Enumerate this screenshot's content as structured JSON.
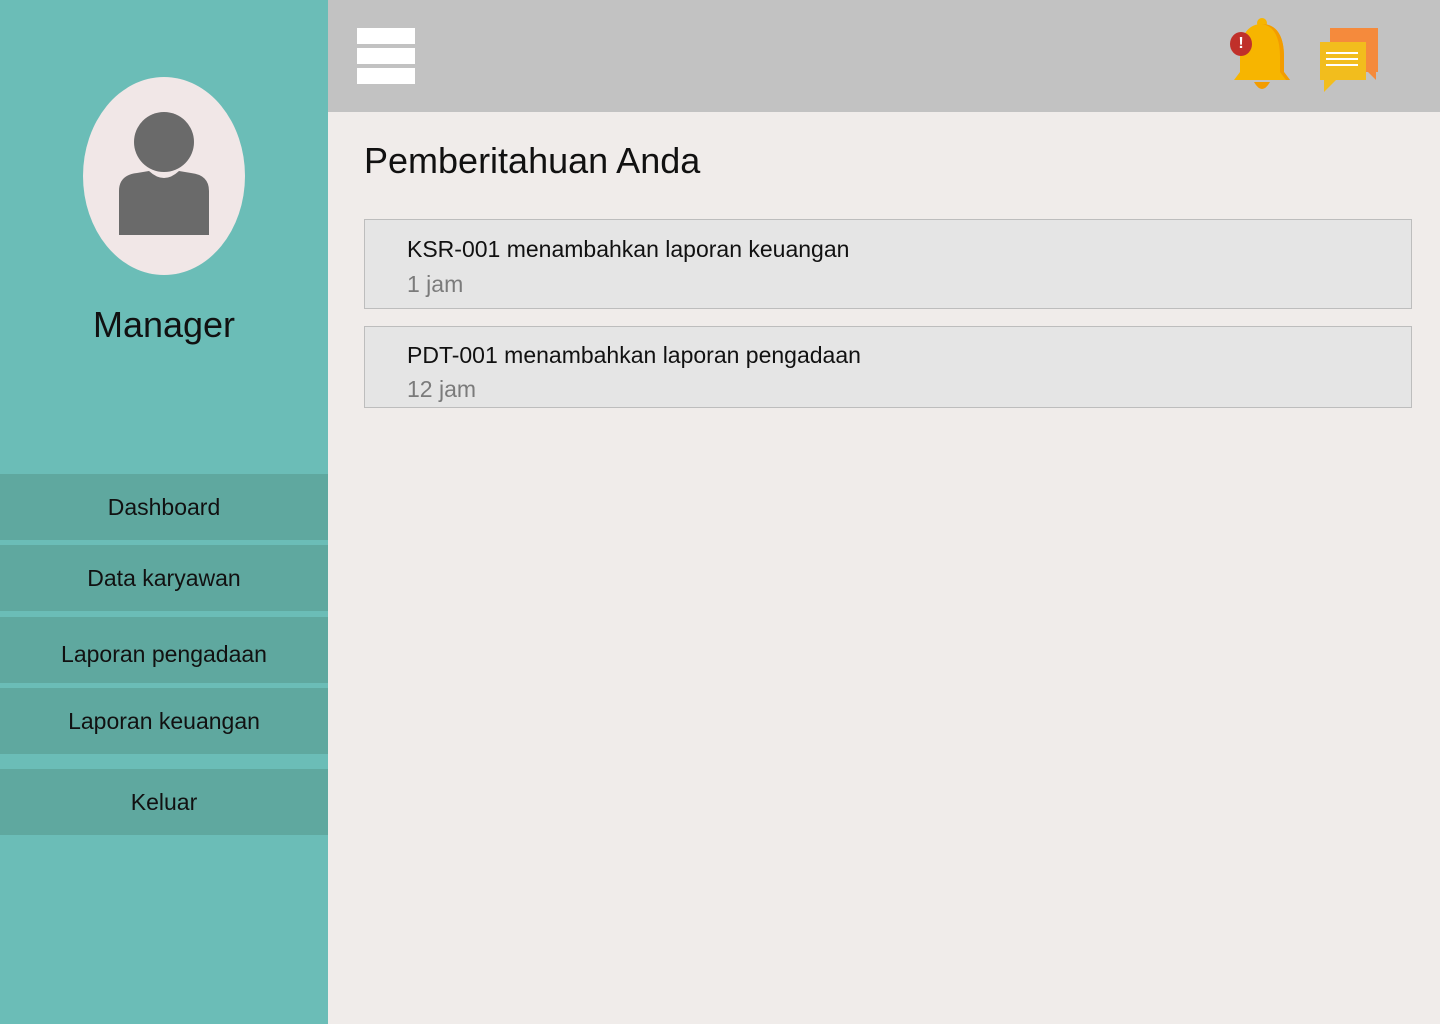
{
  "sidebar": {
    "role": "Manager",
    "items": [
      {
        "label": "Dashboard"
      },
      {
        "label": "Data karyawan"
      },
      {
        "label": "Laporan pengadaan"
      },
      {
        "label": "Laporan keuangan"
      },
      {
        "label": "Keluar"
      }
    ]
  },
  "header": {
    "menu_icon": "hamburger-icon",
    "notification_icon": "bell-icon",
    "notification_badge": "!",
    "message_icon": "chat-icon"
  },
  "main": {
    "title": "Pemberitahuan Anda",
    "notifications": [
      {
        "message": "KSR-001 menambahkan laporan keuangan",
        "time": "1 jam"
      },
      {
        "message": "PDT-001 menambahkan laporan pengadaan",
        "time": "12 jam"
      }
    ]
  },
  "colors": {
    "sidebar": "#6bbdb7",
    "nav_item": "#5fa89f",
    "topbar": "#c2c2c2",
    "background": "#f0ecea",
    "card": "#e5e5e5",
    "bell": "#f7b500",
    "badge": "#c0302a",
    "chat_front": "#f2bd1d",
    "chat_back": "#f58a3c"
  }
}
